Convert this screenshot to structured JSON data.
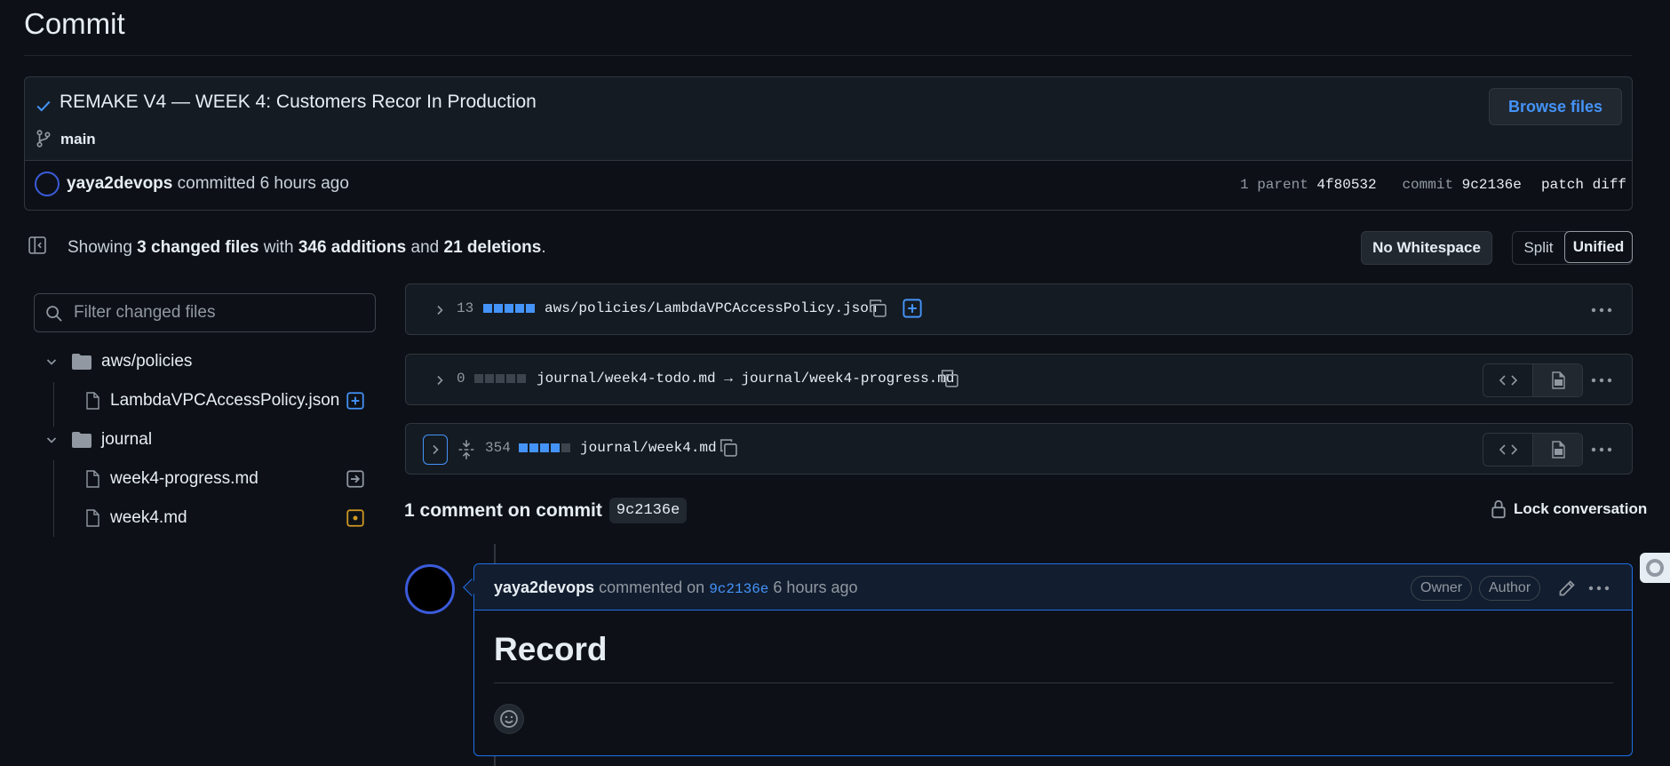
{
  "page": {
    "title": "Commit"
  },
  "commit": {
    "message": "REMAKE V4 — WEEK 4: Customers Recor In Production",
    "branch": "main",
    "browse_files_label": "Browse files",
    "author": "yaya2devops",
    "committed_text": "committed",
    "time": "6 hours ago",
    "parent_label": "1 parent",
    "parent_sha": "4f80532",
    "commit_label": "commit",
    "commit_sha": "9c2136e",
    "patch_label": "patch",
    "diff_label": "diff"
  },
  "summary": {
    "prefix": "Showing",
    "changed_files": "3 changed files",
    "with": "with",
    "additions": "346 additions",
    "and": "and",
    "deletions": "21 deletions",
    "suffix": "."
  },
  "toolbar": {
    "no_whitespace_label": "No Whitespace",
    "split_label": "Split",
    "unified_label": "Unified"
  },
  "file_filter": {
    "placeholder": "Filter changed files"
  },
  "file_tree": {
    "folder_1": "aws/policies",
    "file_1": "LambdaVPCAccessPolicy.json",
    "folder_2": "journal",
    "file_2": "week4-progress.md",
    "file_3": "week4.md"
  },
  "diffs": [
    {
      "count": "13",
      "path": "aws/policies/LambdaVPCAccessPolicy.json",
      "status": "added"
    },
    {
      "count": "0",
      "path": "journal/week4-todo.md → journal/week4-progress.md",
      "status": "renamed"
    },
    {
      "count": "354",
      "path": "journal/week4.md",
      "status": "modified"
    }
  ],
  "comments_section": {
    "heading": "1 comment on commit",
    "sha": "9c2136e",
    "lock_label": "Lock conversation"
  },
  "comment": {
    "author": "yaya2devops",
    "action": "commented on",
    "sha": "9c2136e",
    "time": "6 hours ago",
    "badge_owner": "Owner",
    "badge_author": "Author",
    "body_heading": "Record"
  },
  "colors": {
    "background": "#0d1117",
    "accent": "#4493f8",
    "added": "#3fb950",
    "modified": "#d29922",
    "border": "#30363d"
  }
}
